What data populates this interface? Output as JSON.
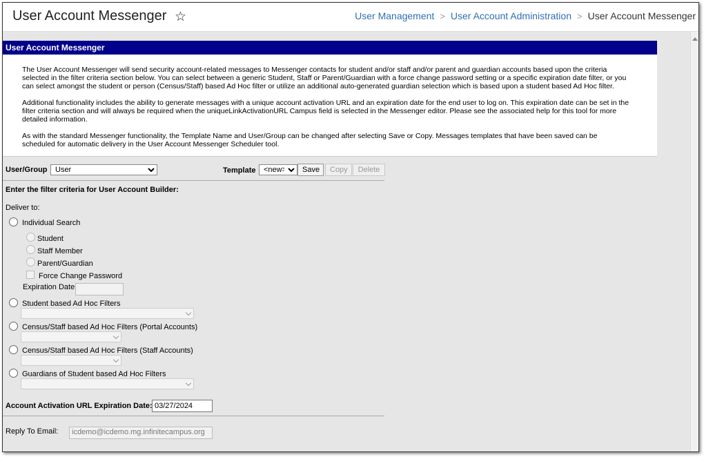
{
  "header": {
    "title": "User Account Messenger",
    "breadcrumb": [
      "User Management",
      "User Account Administration",
      "User Account Messenger"
    ]
  },
  "panel": {
    "title": "User Account Messenger",
    "intro": [
      "The User Account Messenger will send security account-related messages to Messenger contacts for student and/or staff and/or parent and guardian accounts based upon the criteria selected in the filter criteria section below. You can select between a generic Student, Staff or Parent/Guardian with a force change password setting or a specific expiration date filter, or you can select amongst the student or person (Census/Staff) based Ad Hoc filter or utilize an additional auto-generated guardian selection which is based upon a student based Ad Hoc filter.",
      "Additional functionality includes the ability to generate messages with a unique account activation URL and an expiration date for the end user to log on. This expiration date can be set in the filter criteria section and will always be required when the uniqueLinkActivationURL Campus field is selected in the Messenger editor. Please see the associated help for this tool for more detailed information.",
      "As with the standard Messenger functionality, the Template Name and User/Group can be changed after selecting Save or Copy. Messages templates that have been saved can be scheduled for automatic delivery in the User Account Messenger Scheduler tool."
    ]
  },
  "controls": {
    "user_group_label": "User/Group",
    "user_group_value": "User",
    "template_label": "Template",
    "template_value": "<new>",
    "save": "Save",
    "copy": "Copy",
    "delete": "Delete"
  },
  "filter": {
    "heading": "Enter the filter criteria for User Account Builder:",
    "deliver_to": "Deliver to:",
    "individual_search": "Individual Search",
    "student": "Student",
    "staff_member": "Staff Member",
    "parent_guardian": "Parent/Guardian",
    "force_change_password": "Force Change Password",
    "expiration_date": "Expiration Date",
    "student_adhoc": "Student based Ad Hoc Filters",
    "census_portal": "Census/Staff based Ad Hoc Filters (Portal Accounts)",
    "census_staff": "Census/Staff based Ad Hoc Filters (Staff Accounts)",
    "guardians_adhoc": "Guardians of Student based Ad Hoc Filters"
  },
  "activation": {
    "label": "Account Activation URL Expiration Date:",
    "value": "03/27/2024"
  },
  "reply": {
    "label": "Reply To Email:",
    "value": "icdemo@icdemo.mg.infinitecampus.org"
  },
  "colors": {
    "header_bar": "#00008b",
    "link": "#2f6fb4"
  }
}
